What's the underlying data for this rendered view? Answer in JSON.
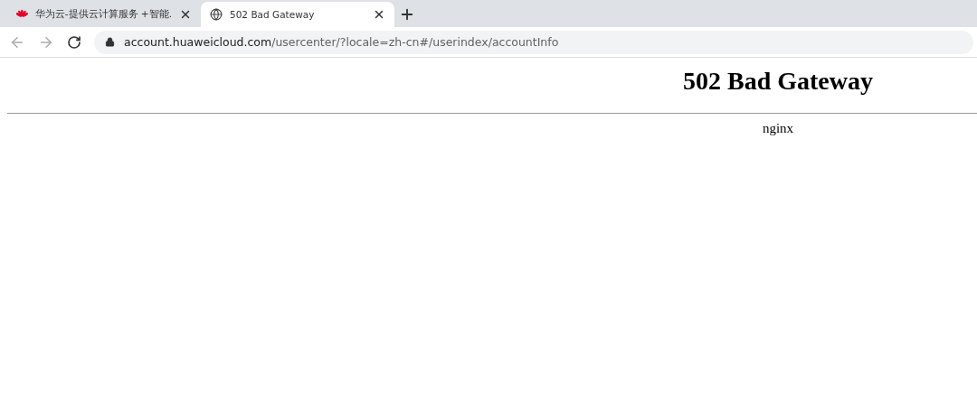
{
  "tabs": [
    {
      "title": "华为云-提供云计算服务 +智能.",
      "selected": false,
      "kind": "brand"
    },
    {
      "title": "502 Bad Gateway",
      "selected": true,
      "kind": "web"
    }
  ],
  "address_bar": {
    "host": "account.huaweicloud.com",
    "path": "/usercenter/?locale=zh-cn#/userindex/accountInfo"
  },
  "page": {
    "heading": "502 Bad Gateway",
    "server": "nginx"
  }
}
